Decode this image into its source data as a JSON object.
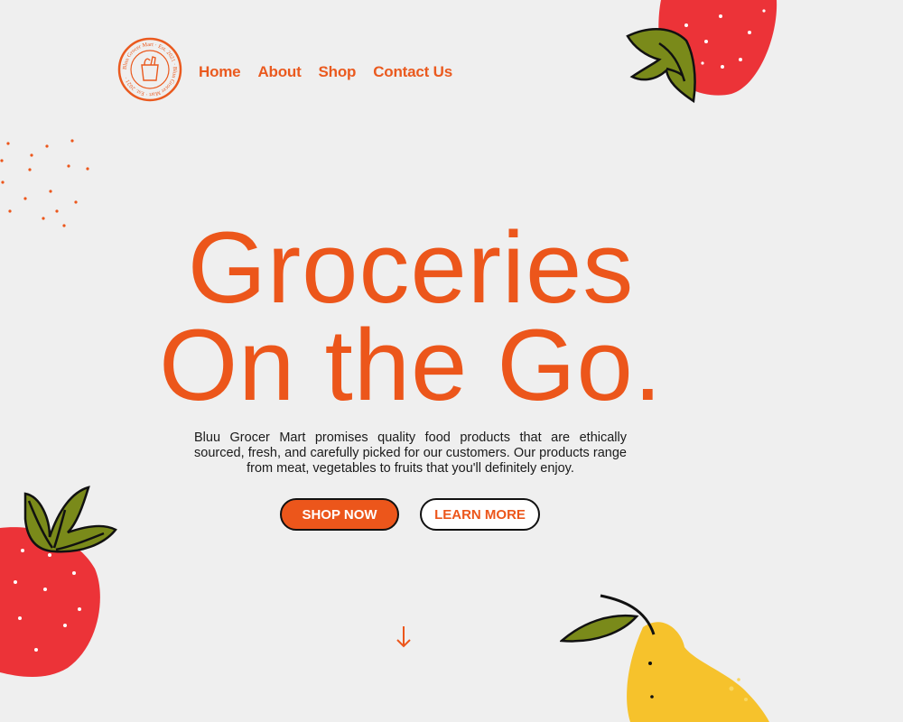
{
  "brand": {
    "name": "Bluu Grocer Mart",
    "logo_ring_text": "Bluu Grocer Mart · Est. 2021 · Bluu Grocer Mart · Est. 2021 ·"
  },
  "nav": {
    "items": [
      {
        "label": "Home"
      },
      {
        "label": "About"
      },
      {
        "label": "Shop"
      },
      {
        "label": "Contact Us"
      }
    ]
  },
  "hero": {
    "title_line1": "Groceries",
    "title_line2": "On the Go.",
    "description": "Bluu Grocer Mart promises quality food products that are ethically sourced, fresh, and carefully picked for our customers. Our products range from meat, vegetables to fruits that you'll definitely enjoy.",
    "primary_button": "SHOP NOW",
    "secondary_button": "LEARN MORE"
  },
  "colors": {
    "accent": "#ec561b",
    "background": "#efefef",
    "strawberry": "#ec3338",
    "leaf": "#7a8a1a",
    "pear": "#f6c22c"
  },
  "icons": {
    "scroll": "arrow-down-icon",
    "logo": "grocery-bag-icon"
  }
}
